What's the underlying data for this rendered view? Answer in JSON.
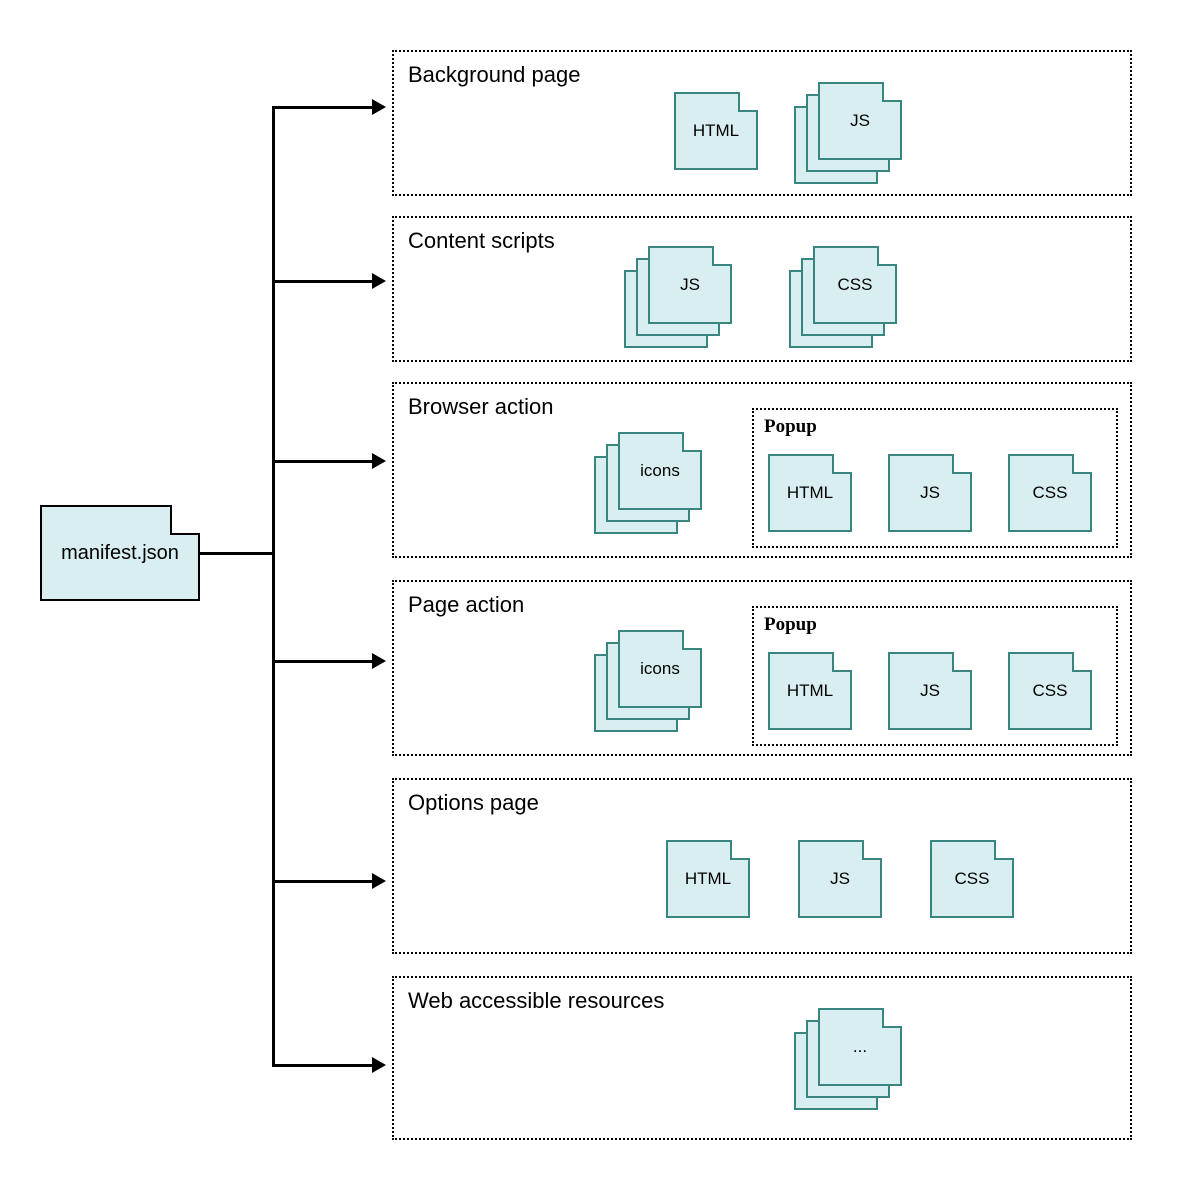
{
  "root": {
    "label": "manifest.json"
  },
  "sections": {
    "background_page": {
      "title": "Background page",
      "files": [
        "HTML",
        "JS"
      ]
    },
    "content_scripts": {
      "title": "Content scripts",
      "files": [
        "JS",
        "CSS"
      ]
    },
    "browser_action": {
      "title": "Browser action",
      "icons_label": "icons",
      "popup": {
        "title": "Popup",
        "files": [
          "HTML",
          "JS",
          "CSS"
        ]
      }
    },
    "page_action": {
      "title": "Page action",
      "icons_label": "icons",
      "popup": {
        "title": "Popup",
        "files": [
          "HTML",
          "JS",
          "CSS"
        ]
      }
    },
    "options_page": {
      "title": "Options page",
      "files": [
        "HTML",
        "JS",
        "CSS"
      ]
    },
    "web_resources": {
      "title": "Web accessible resources",
      "file_label": "..."
    }
  }
}
